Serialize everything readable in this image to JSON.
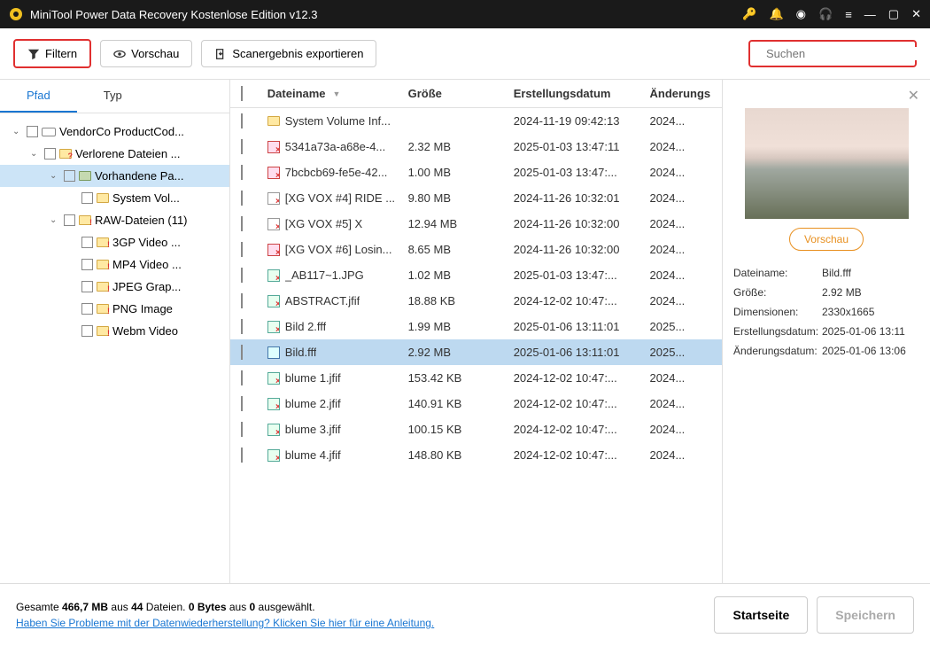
{
  "titlebar": {
    "title": "MiniTool Power Data Recovery Kostenlose Edition v12.3"
  },
  "toolbar": {
    "filter_label": "Filtern",
    "preview_label": "Vorschau",
    "export_label": "Scanergebnis exportieren",
    "search_placeholder": "Suchen"
  },
  "tabs": {
    "path": "Pfad",
    "type": "Typ"
  },
  "tree": {
    "root": "VendorCo ProductCod...",
    "lost": "Verlorene Dateien ...",
    "existing": "Vorhandene Pa...",
    "sysvol": "System Vol...",
    "raw": "RAW-Dateien (11)",
    "c0": "3GP Video ...",
    "c1": "MP4 Video ...",
    "c2": "JPEG Grap...",
    "c3": "PNG Image",
    "c4": "Webm Video"
  },
  "columns": {
    "name": "Dateiname",
    "size": "Größe",
    "created": "Erstellungsdatum",
    "modified": "Änderungs"
  },
  "files": [
    {
      "name": "System Volume Inf...",
      "size": "",
      "created": "2024-11-19 09:42:13",
      "mod": "2024...",
      "type": "folder"
    },
    {
      "name": "5341a73a-a68e-4...",
      "size": "2.32 MB",
      "created": "2025-01-03 13:47:11",
      "mod": "2024...",
      "type": "pdf"
    },
    {
      "name": "7bcbcb69-fe5e-42...",
      "size": "1.00 MB",
      "created": "2025-01-03 13:47:...",
      "mod": "2024...",
      "type": "pdf"
    },
    {
      "name": "[XG VOX #4] RIDE ...",
      "size": "9.80 MB",
      "created": "2024-11-26 10:32:01",
      "mod": "2024...",
      "type": "doc"
    },
    {
      "name": "[XG VOX #5] X",
      "size": "12.94 MB",
      "created": "2024-11-26 10:32:00",
      "mod": "2024...",
      "type": "doc"
    },
    {
      "name": "[XG VOX #6] Losin...",
      "size": "8.65 MB",
      "created": "2024-11-26 10:32:00",
      "mod": "2024...",
      "type": "pdf"
    },
    {
      "name": "_AB117~1.JPG",
      "size": "1.02 MB",
      "created": "2025-01-03 13:47:...",
      "mod": "2024...",
      "type": "img"
    },
    {
      "name": "ABSTRACT.jfif",
      "size": "18.88 KB",
      "created": "2024-12-02 10:47:...",
      "mod": "2024...",
      "type": "img"
    },
    {
      "name": "Bild 2.fff",
      "size": "1.99 MB",
      "created": "2025-01-06 13:11:01",
      "mod": "2025...",
      "type": "img"
    },
    {
      "name": "Bild.fff",
      "size": "2.92 MB",
      "created": "2025-01-06 13:11:01",
      "mod": "2025...",
      "type": "sel"
    },
    {
      "name": "blume 1.jfif",
      "size": "153.42 KB",
      "created": "2024-12-02 10:47:...",
      "mod": "2024...",
      "type": "img"
    },
    {
      "name": "blume 2.jfif",
      "size": "140.91 KB",
      "created": "2024-12-02 10:47:...",
      "mod": "2024...",
      "type": "img"
    },
    {
      "name": "blume 3.jfif",
      "size": "100.15 KB",
      "created": "2024-12-02 10:47:...",
      "mod": "2024...",
      "type": "img"
    },
    {
      "name": "blume 4.jfif",
      "size": "148.80 KB",
      "created": "2024-12-02 10:47:...",
      "mod": "2024...",
      "type": "img"
    }
  ],
  "preview": {
    "button": "Vorschau",
    "labels": {
      "name": "Dateiname:",
      "size": "Größe:",
      "dimensions": "Dimensionen:",
      "created": "Erstellungsdatum:",
      "modified": "Änderungsdatum:"
    },
    "values": {
      "name": "Bild.fff",
      "size": "2.92 MB",
      "dimensions": "2330x1665",
      "created": "2025-01-06 13:11",
      "modified": "2025-01-06 13:06"
    }
  },
  "statusbar": {
    "total_pre": "Gesamte ",
    "total_size": "466,7 MB",
    "total_mid": " aus ",
    "total_files": "44",
    "total_post": " Dateien.  ",
    "sel_size": "0 Bytes",
    "sel_mid": " aus ",
    "sel_count": "0",
    "sel_post": " ausgewählt.",
    "help_link": "Haben Sie Probleme mit der Datenwiederherstellung? Klicken Sie hier für eine Anleitung.",
    "home_btn": "Startseite",
    "save_btn": "Speichern"
  }
}
